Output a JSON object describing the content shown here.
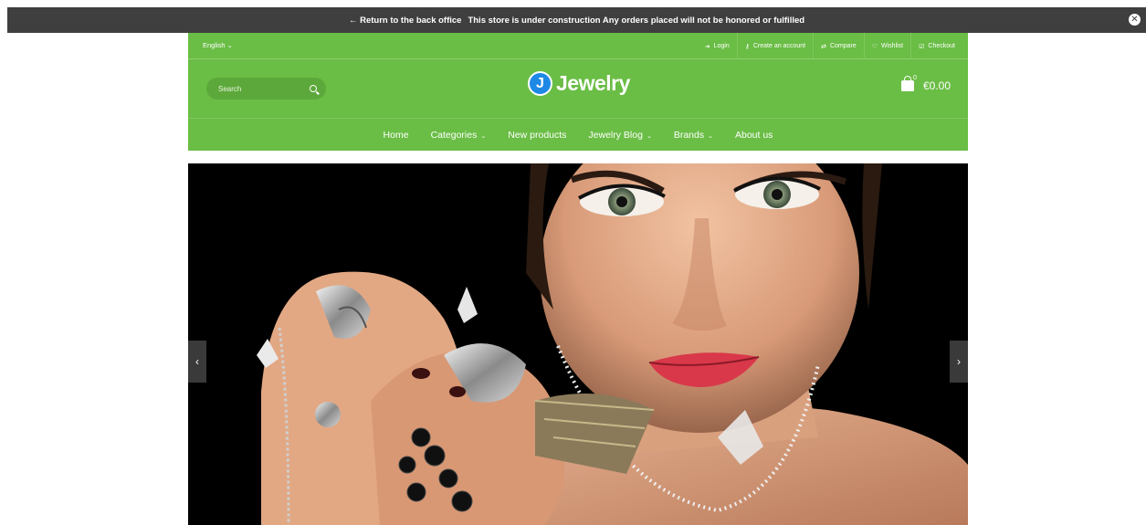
{
  "notice": {
    "back_label": "← Return to the back office",
    "message": "This store is under construction Any orders placed will not be honored or fulfilled"
  },
  "topbar": {
    "language": "English ⌄",
    "links": [
      {
        "icon": "login-icon",
        "glyph": "➔",
        "label": "Login"
      },
      {
        "icon": "key-icon",
        "glyph": "⚷",
        "label": "Create an account"
      },
      {
        "icon": "compare-icon",
        "glyph": "⇄",
        "label": "Compare"
      },
      {
        "icon": "heart-icon",
        "glyph": "♡",
        "label": "Wishlist"
      },
      {
        "icon": "checkout-icon",
        "glyph": "☑",
        "label": "Checkout"
      }
    ]
  },
  "search": {
    "placeholder": "Search"
  },
  "logo": {
    "letter": "J",
    "text": "Jewelry"
  },
  "cart": {
    "count": "0",
    "total": "€0.00"
  },
  "nav": {
    "home": "Home",
    "categories": "Categories",
    "new_products": "New products",
    "blog": "Jewelry Blog",
    "brands": "Brands",
    "about": "About us"
  },
  "slider": {
    "prev": "‹",
    "next": "›"
  },
  "colors": {
    "brand_green": "#6abd45",
    "logo_blue": "#1e88e5",
    "notice_bg": "#3f3f3f"
  }
}
